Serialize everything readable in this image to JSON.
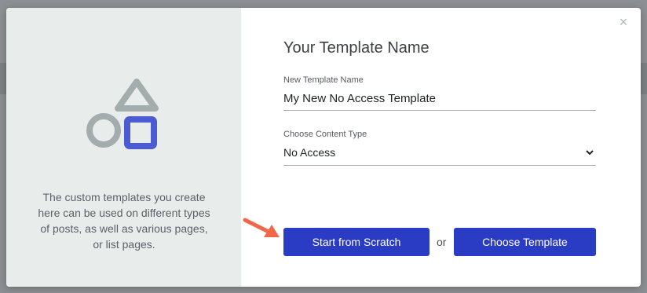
{
  "modal": {
    "close_symbol": "×",
    "left": {
      "illustration": "shapes-illustration",
      "description": "The custom templates you create here can be used on different types of posts, as well as various pages, or list pages."
    },
    "title": "Your Template Name",
    "name_field": {
      "label": "New Template Name",
      "value": "My New No Access Template"
    },
    "content_type": {
      "label": "Choose Content Type",
      "selected": "No Access"
    },
    "buttons": {
      "scratch": "Start from Scratch",
      "or": "or",
      "template": "Choose Template"
    }
  },
  "colors": {
    "primary_button": "#2b3cc4",
    "left_panel_bg": "#e8eceb",
    "shape_gray": "#a3adad",
    "shape_blue": "#4b5bd1",
    "arrow": "#f0674a"
  }
}
